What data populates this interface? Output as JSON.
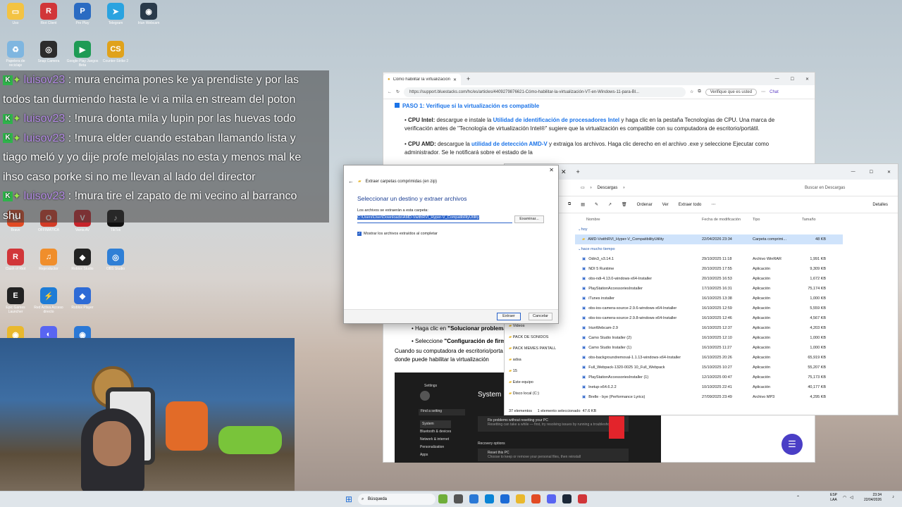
{
  "desktop_icons": [
    {
      "label": "Uso",
      "color": "#f3c343",
      "glyph": "▭"
    },
    {
      "label": "Riot Client",
      "color": "#d13639",
      "glyph": "R"
    },
    {
      "label": "Pro Play",
      "color": "#2a6bc2",
      "glyph": "P"
    },
    {
      "label": "Telegram",
      "color": "#2aa3e0",
      "glyph": "➤"
    },
    {
      "label": "Iriun Webcam",
      "color": "#2a3a4a",
      "glyph": "◉"
    },
    {
      "label": "Papelera de reciclaje",
      "color": "#7fb6e0",
      "glyph": "♻"
    },
    {
      "label": "Snap Camera",
      "color": "#2c2c2c",
      "glyph": "◎"
    },
    {
      "label": "Google Play Juegos Beta",
      "color": "#1e9b55",
      "glyph": "▶"
    },
    {
      "label": "Counter-Strike 2",
      "color": "#e0a21b",
      "glyph": "CS"
    },
    {
      "label": "Brave",
      "color": "#e24b24",
      "glyph": "B"
    },
    {
      "label": "OFFIMATICA",
      "color": "#d33b26",
      "glyph": "O"
    },
    {
      "label": "Vanta AV",
      "color": "#c7242b",
      "glyph": "V"
    },
    {
      "label": "TikTok",
      "color": "#111111",
      "glyph": "♪"
    },
    {
      "label": "Clash of Riot",
      "color": "#d13639",
      "glyph": "R"
    },
    {
      "label": "Reproductor",
      "color": "#f08e2b",
      "glyph": "♫"
    },
    {
      "label": "Roblox Studio",
      "color": "#222222",
      "glyph": "◆"
    },
    {
      "label": "OBS Studio",
      "color": "#2f7fd6",
      "glyph": "◎"
    },
    {
      "label": "Epic Games Launcher",
      "color": "#222222",
      "glyph": "E"
    },
    {
      "label": "Red Activa Acceso directo",
      "color": "#1e7cd6",
      "glyph": "⚡"
    },
    {
      "label": "Roblox Player",
      "color": "#2e6bd6",
      "glyph": "◆"
    },
    {
      "label": "Chrome",
      "color": "#e9b82d",
      "glyph": "◉"
    },
    {
      "label": "Discord",
      "color": "#5865f2",
      "glyph": "◐"
    },
    {
      "label": "Iriun",
      "color": "#2a78d6",
      "glyph": "◉"
    }
  ],
  "chat": [
    {
      "user": "luisov23",
      "text": "mura encima pones ke ya prendiste y por las"
    },
    {
      "user": "",
      "text": "todos tan durmiendo hasta le vi a mila en stream del poton"
    },
    {
      "user": "luisov23",
      "text": "!mura donta mila y lupin por las huevas todo"
    },
    {
      "user": "luisov23",
      "text": "!mura elder cuando estaban llamando lista y"
    },
    {
      "user": "",
      "text": "tiago meló y yo dije profe melojalas no esta y menos mal ke"
    },
    {
      "user": "",
      "text": "ihso caso porke si no me llevan al lado del director"
    },
    {
      "user": "luisov23",
      "text": "!mura tire el zapato de mi vecino al barranco"
    },
    {
      "user": "",
      "text": "shu"
    }
  ],
  "browser": {
    "tab_title": "Cómo habilitar la virtualización (VT...",
    "url": "https://support.bluestacks.com/hc/es/articles/4409279876621-Cómo-habilitar-la-virtualización-VT-en-Windows-11-para-Bl...",
    "verify_label": "Verifique que es usted",
    "chat_label": "Chat",
    "step_title": "PASO 1: Verifique si la virtualización es compatible",
    "cpu_intel_label": "CPU Intel:",
    "cpu_intel_a": "descargue e instale la",
    "cpu_intel_link": "Utilidad de identificación de procesadores Intel",
    "cpu_intel_b": "y haga clic en la pestaña Tecnologías de CPU. Una marca de verificación antes de \"Tecnología de virtualización Intel®\" sugiere que la virtualización es compatible con su computadora de escritorio/portátil.",
    "cpu_amd_label": "CPU AMD:",
    "cpu_amd_a": "descargue la",
    "cpu_amd_link": "utilidad de detección AMD-V",
    "cpu_amd_b": "y extraiga los archivos. Haga clic derecho en el archivo .exe y seleccione Ejecutar como administrador. Se le notificará sobre el estado de la",
    "bullet1_a": "Haga clic en",
    "bullet1_b": "\"Solucionar problema",
    "bullet2_a": "Seleccione",
    "bullet2_b": "\"Configuración de firm",
    "para_a": "Cuando su computadora de escritorio/porta",
    "para_b": "donde puede habilitar la virtualización",
    "settings_title": "Settings",
    "system_label": "System",
    "find_setting": "Find a setting",
    "settings_menu": [
      "System",
      "Bluetooth & devices",
      "Network & internet",
      "Personalization",
      "Apps"
    ],
    "fix_text": "Fix problems without resetting your PC",
    "fix_sub": "Resetting can take a while — first, try resolving issues by running a troubleshooter",
    "recovery_options": "Recovery options",
    "reset_pc": "Reset this PC",
    "reset_sub": "Choose to keep or remove your personal files, then reinstall"
  },
  "explorer": {
    "address": "Descargas",
    "search_placeholder": "Buscar en Descargas",
    "toolbar": {
      "sort": "Ordenar",
      "view": "Ver",
      "extract_all": "Extraer todo",
      "details": "Detalles"
    },
    "columns": {
      "name": "Nombre",
      "date": "Fecha de modificación",
      "type": "Tipo",
      "size": "Tamaño"
    },
    "group_today": "hoy",
    "group_old": "hace mucho tiempo",
    "today_files": [
      {
        "name": "AMD-VwithRVI_Hyper-V_CompatibilityUtility",
        "date": "22/04/2026 23:34",
        "type": "Carpeta comprimi...",
        "size": "48 KB"
      }
    ],
    "files": [
      {
        "name": "Odin3_v3.14.1",
        "date": "29/10/2025 11:18",
        "type": "Archivo WinRAR",
        "size": "1,991 KB"
      },
      {
        "name": "NDI 5 Runtime",
        "date": "20/10/2025 17:55",
        "type": "Aplicación",
        "size": "9,309 KB"
      },
      {
        "name": "obs-ndi-4.13.0-windows-x64-Installer",
        "date": "20/10/2025 16:53",
        "type": "Aplicación",
        "size": "1,672 KB"
      },
      {
        "name": "PlayStationAccessoriesInstaller",
        "date": "17/10/2025 16:31",
        "type": "Aplicación",
        "size": "75,174 KB"
      },
      {
        "name": "iTunes installer",
        "date": "16/10/2025 13:38",
        "type": "Aplicación",
        "size": "1,000 KB"
      },
      {
        "name": "obs-ios-camera-source-2.9.6-windows-x64-Installer",
        "date": "16/10/2025 12:59",
        "type": "Aplicación",
        "size": "5,559 KB"
      },
      {
        "name": "obs-ios-camera-source-2.9.8-windows-x64-Installer",
        "date": "16/10/2025 12:46",
        "type": "Aplicación",
        "size": "4,567 KB"
      },
      {
        "name": "IriunWebcam-2.9",
        "date": "16/10/2025 12:37",
        "type": "Aplicación",
        "size": "4,203 KB"
      },
      {
        "name": "Camo Studio Installer (2)",
        "date": "16/10/2025 12:10",
        "type": "Aplicación",
        "size": "1,000 KB"
      },
      {
        "name": "Camo Studio Installer (1)",
        "date": "16/10/2025 11:27",
        "type": "Aplicación",
        "size": "1,000 KB"
      },
      {
        "name": "obs-backgroundremoval-1.1.13-windows-x64-Installer",
        "date": "16/10/2025 20:26",
        "type": "Aplicación",
        "size": "65,919 KB"
      },
      {
        "name": "Full_Webpack-1320-0025 10_Full_Webpack",
        "date": "15/10/2025 10:27",
        "type": "Aplicación",
        "size": "55,207 KB"
      },
      {
        "name": "PlayStationAccessoriesInstaller (1)",
        "date": "12/10/2025 00:47",
        "type": "Aplicación",
        "size": "75,173 KB"
      },
      {
        "name": "lnetup-x64.6.2.2",
        "date": "10/10/2025 22:41",
        "type": "Aplicación",
        "size": "40,177 KB"
      },
      {
        "name": "Brelle - bye (Performance Lyrics)",
        "date": "27/09/2025 23:49",
        "type": "Archivo MP3",
        "size": "4,295 KB"
      }
    ],
    "sidebar": [
      "Videos",
      "PACK DE SONIDOS",
      "PACK MEMES PANTALL",
      "adsa",
      "15",
      "Este equipo",
      "Disco local (C:)"
    ],
    "status": "37 elementos     1 elemento seleccionado  47.6 KB"
  },
  "dialog": {
    "title": "Extraer carpetas comprimidas (en zip)",
    "heading": "Seleccionar un destino y extraer archivos",
    "label": "Los archivos se extraerán a esta carpeta:",
    "path": "C:\\Users\\User\\Downloads\\AMD-VwithRVI_Hyper-V_CompatibilityUtility",
    "browse": "Examinar...",
    "checkbox": "Mostrar los archivos extraídos al completar",
    "extract": "Extraer",
    "cancel": "Cancelar"
  },
  "taskbar": {
    "search": "Búsqueda",
    "lang": "ESP",
    "lang2": "LAA",
    "time": "23:34",
    "date": "22/04/2026"
  }
}
